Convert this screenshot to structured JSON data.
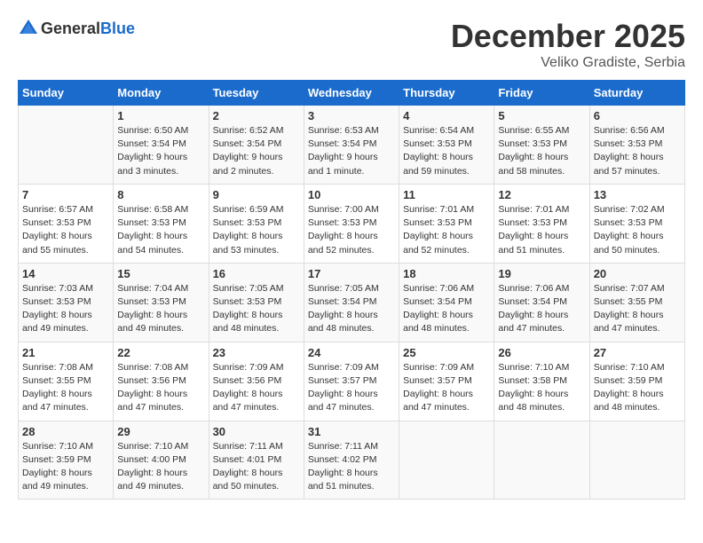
{
  "logo": {
    "general": "General",
    "blue": "Blue"
  },
  "header": {
    "month": "December 2025",
    "location": "Veliko Gradiste, Serbia"
  },
  "weekdays": [
    "Sunday",
    "Monday",
    "Tuesday",
    "Wednesday",
    "Thursday",
    "Friday",
    "Saturday"
  ],
  "weeks": [
    [
      {
        "day": "",
        "info": ""
      },
      {
        "day": "1",
        "info": "Sunrise: 6:50 AM\nSunset: 3:54 PM\nDaylight: 9 hours\nand 3 minutes."
      },
      {
        "day": "2",
        "info": "Sunrise: 6:52 AM\nSunset: 3:54 PM\nDaylight: 9 hours\nand 2 minutes."
      },
      {
        "day": "3",
        "info": "Sunrise: 6:53 AM\nSunset: 3:54 PM\nDaylight: 9 hours\nand 1 minute."
      },
      {
        "day": "4",
        "info": "Sunrise: 6:54 AM\nSunset: 3:53 PM\nDaylight: 8 hours\nand 59 minutes."
      },
      {
        "day": "5",
        "info": "Sunrise: 6:55 AM\nSunset: 3:53 PM\nDaylight: 8 hours\nand 58 minutes."
      },
      {
        "day": "6",
        "info": "Sunrise: 6:56 AM\nSunset: 3:53 PM\nDaylight: 8 hours\nand 57 minutes."
      }
    ],
    [
      {
        "day": "7",
        "info": "Sunrise: 6:57 AM\nSunset: 3:53 PM\nDaylight: 8 hours\nand 55 minutes."
      },
      {
        "day": "8",
        "info": "Sunrise: 6:58 AM\nSunset: 3:53 PM\nDaylight: 8 hours\nand 54 minutes."
      },
      {
        "day": "9",
        "info": "Sunrise: 6:59 AM\nSunset: 3:53 PM\nDaylight: 8 hours\nand 53 minutes."
      },
      {
        "day": "10",
        "info": "Sunrise: 7:00 AM\nSunset: 3:53 PM\nDaylight: 8 hours\nand 52 minutes."
      },
      {
        "day": "11",
        "info": "Sunrise: 7:01 AM\nSunset: 3:53 PM\nDaylight: 8 hours\nand 52 minutes."
      },
      {
        "day": "12",
        "info": "Sunrise: 7:01 AM\nSunset: 3:53 PM\nDaylight: 8 hours\nand 51 minutes."
      },
      {
        "day": "13",
        "info": "Sunrise: 7:02 AM\nSunset: 3:53 PM\nDaylight: 8 hours\nand 50 minutes."
      }
    ],
    [
      {
        "day": "14",
        "info": "Sunrise: 7:03 AM\nSunset: 3:53 PM\nDaylight: 8 hours\nand 49 minutes."
      },
      {
        "day": "15",
        "info": "Sunrise: 7:04 AM\nSunset: 3:53 PM\nDaylight: 8 hours\nand 49 minutes."
      },
      {
        "day": "16",
        "info": "Sunrise: 7:05 AM\nSunset: 3:53 PM\nDaylight: 8 hours\nand 48 minutes."
      },
      {
        "day": "17",
        "info": "Sunrise: 7:05 AM\nSunset: 3:54 PM\nDaylight: 8 hours\nand 48 minutes."
      },
      {
        "day": "18",
        "info": "Sunrise: 7:06 AM\nSunset: 3:54 PM\nDaylight: 8 hours\nand 48 minutes."
      },
      {
        "day": "19",
        "info": "Sunrise: 7:06 AM\nSunset: 3:54 PM\nDaylight: 8 hours\nand 47 minutes."
      },
      {
        "day": "20",
        "info": "Sunrise: 7:07 AM\nSunset: 3:55 PM\nDaylight: 8 hours\nand 47 minutes."
      }
    ],
    [
      {
        "day": "21",
        "info": "Sunrise: 7:08 AM\nSunset: 3:55 PM\nDaylight: 8 hours\nand 47 minutes."
      },
      {
        "day": "22",
        "info": "Sunrise: 7:08 AM\nSunset: 3:56 PM\nDaylight: 8 hours\nand 47 minutes."
      },
      {
        "day": "23",
        "info": "Sunrise: 7:09 AM\nSunset: 3:56 PM\nDaylight: 8 hours\nand 47 minutes."
      },
      {
        "day": "24",
        "info": "Sunrise: 7:09 AM\nSunset: 3:57 PM\nDaylight: 8 hours\nand 47 minutes."
      },
      {
        "day": "25",
        "info": "Sunrise: 7:09 AM\nSunset: 3:57 PM\nDaylight: 8 hours\nand 47 minutes."
      },
      {
        "day": "26",
        "info": "Sunrise: 7:10 AM\nSunset: 3:58 PM\nDaylight: 8 hours\nand 48 minutes."
      },
      {
        "day": "27",
        "info": "Sunrise: 7:10 AM\nSunset: 3:59 PM\nDaylight: 8 hours\nand 48 minutes."
      }
    ],
    [
      {
        "day": "28",
        "info": "Sunrise: 7:10 AM\nSunset: 3:59 PM\nDaylight: 8 hours\nand 49 minutes."
      },
      {
        "day": "29",
        "info": "Sunrise: 7:10 AM\nSunset: 4:00 PM\nDaylight: 8 hours\nand 49 minutes."
      },
      {
        "day": "30",
        "info": "Sunrise: 7:11 AM\nSunset: 4:01 PM\nDaylight: 8 hours\nand 50 minutes."
      },
      {
        "day": "31",
        "info": "Sunrise: 7:11 AM\nSunset: 4:02 PM\nDaylight: 8 hours\nand 51 minutes."
      },
      {
        "day": "",
        "info": ""
      },
      {
        "day": "",
        "info": ""
      },
      {
        "day": "",
        "info": ""
      }
    ]
  ]
}
